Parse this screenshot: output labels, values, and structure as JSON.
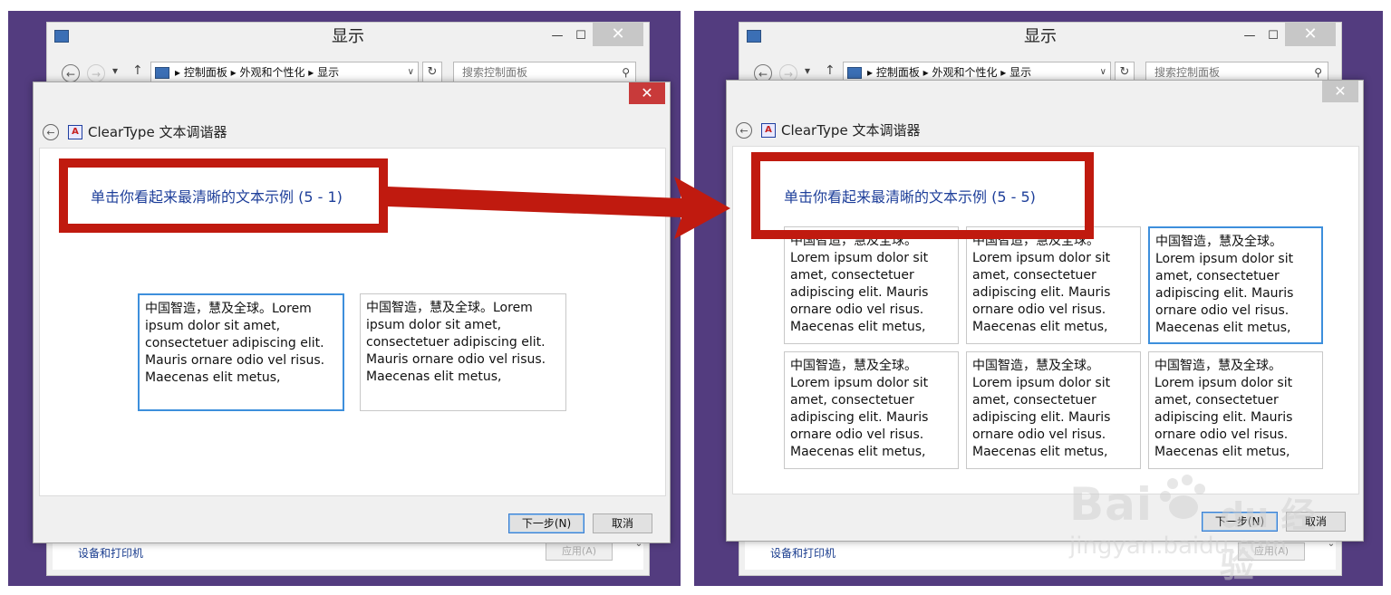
{
  "explorer": {
    "title": "显示",
    "minimize_glyph": "—",
    "maximize_glyph": "☐",
    "close_glyph": "✕",
    "back_glyph": "←",
    "forward_glyph": "→",
    "history_glyph": "▾",
    "up_glyph": "↑",
    "address_path": "▸  控制面板  ▸  外观和个性化  ▸  显示",
    "address_dropdown_glyph": "∨",
    "refresh_glyph": "↻",
    "search_placeholder": "搜索控制面板",
    "search_icon_glyph": "⚲",
    "devices_link": "设备和打印机",
    "apply_button": "应用(A)",
    "scroll_down_glyph": "⌄"
  },
  "left": {
    "dialog": {
      "close_glyph": "✕",
      "back_glyph": "←",
      "app_icon_letter": "A",
      "title": "ClearType 文本调谐器",
      "instruction": "单击你看起来最清晰的文本示例 (5 - 1)",
      "samples": [
        {
          "text": "中国智造，慧及全球。Lorem ipsum dolor sit amet, consectetuer adipiscing elit. Mauris ornare odio vel risus. Maecenas elit metus,",
          "selected": true
        },
        {
          "text": "中国智造，慧及全球。Lorem ipsum dolor sit amet, consectetuer adipiscing elit. Mauris ornare odio vel risus. Maecenas elit metus,",
          "selected": false
        }
      ],
      "next_button": "下一步(N)",
      "cancel_button": "取消"
    }
  },
  "right": {
    "dialog": {
      "close_glyph": "✕",
      "back_glyph": "←",
      "app_icon_letter": "A",
      "title": "ClearType 文本调谐器",
      "instruction": "单击你看起来最清晰的文本示例 (5 - 5)",
      "samples": [
        {
          "text": "中国智造，慧及全球。Lorem ipsum dolor sit amet, consectetuer adipiscing elit. Mauris ornare odio vel risus. Maecenas elit metus,",
          "selected": false
        },
        {
          "text": "中国智造，慧及全球。Lorem ipsum dolor sit amet, consectetuer adipiscing elit. Mauris ornare odio vel risus. Maecenas elit metus,",
          "selected": false
        },
        {
          "text": "中国智造，慧及全球。Lorem ipsum dolor sit amet, consectetuer adipiscing elit. Mauris ornare odio vel risus. Maecenas elit metus,",
          "selected": true
        },
        {
          "text": "中国智造，慧及全球。Lorem ipsum dolor sit amet, consectetuer adipiscing elit. Mauris ornare odio vel risus. Maecenas elit metus,",
          "selected": false
        },
        {
          "text": "中国智造，慧及全球。Lorem ipsum dolor sit amet, consectetuer adipiscing elit. Mauris ornare odio vel risus. Maecenas elit metus,",
          "selected": false
        },
        {
          "text": "中国智造，慧及全球。Lorem ipsum dolor sit amet, consectetuer adipiscing elit. Mauris ornare odio vel risus. Maecenas elit metus,",
          "selected": false
        }
      ],
      "next_button": "下一步(N)",
      "cancel_button": "取消"
    }
  },
  "watermark": {
    "logo": "Bai",
    "logo_suffix": "du 经验",
    "url": "jingyan.baidu.com"
  },
  "colors": {
    "panel_bg": "#533c7f",
    "highlight_red": "#c01a0f",
    "instruction_blue": "#1e3f9a",
    "selected_border": "#3d8fdc"
  }
}
